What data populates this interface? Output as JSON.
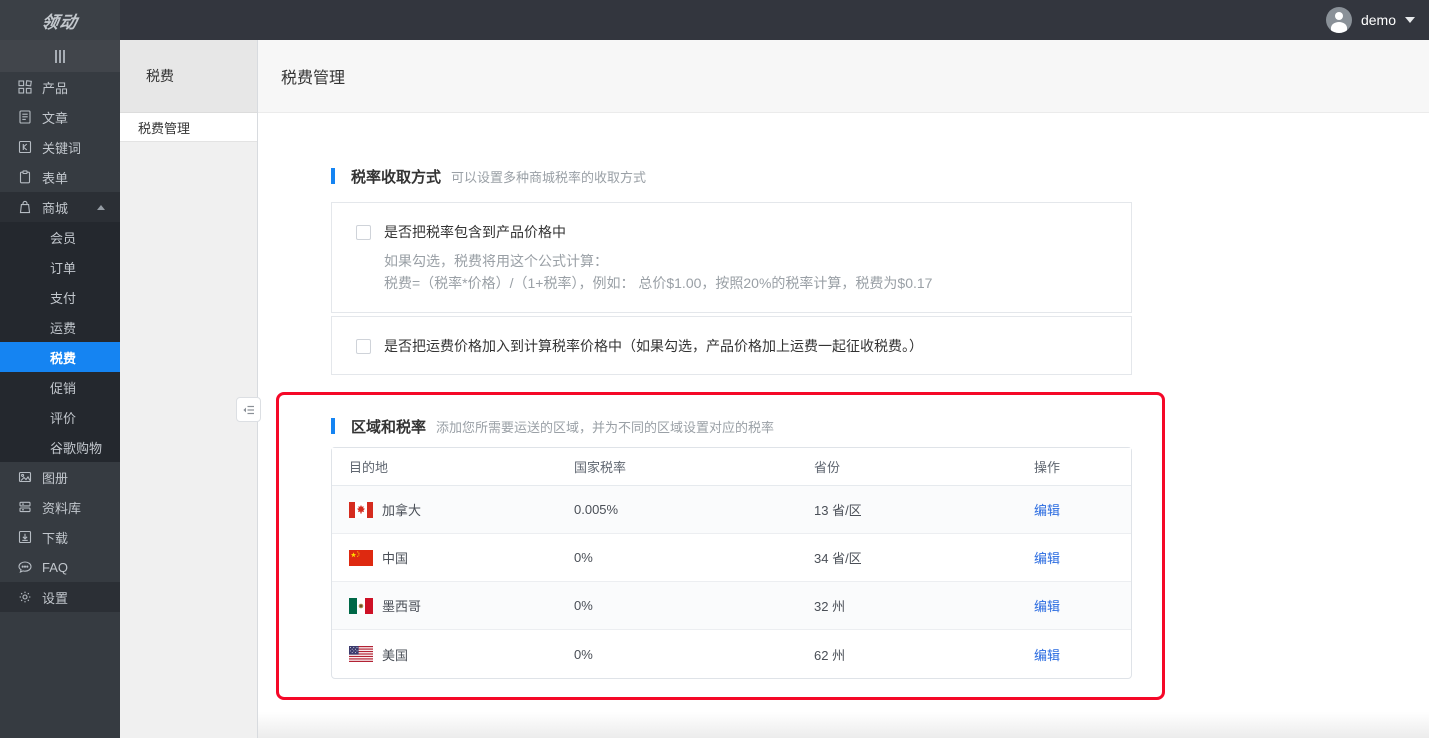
{
  "topbar": {
    "logo": "领动",
    "user": "demo"
  },
  "sidebar": {
    "items": [
      {
        "label": "产品",
        "icon": "grid-icon"
      },
      {
        "label": "文章",
        "icon": "article-icon"
      },
      {
        "label": "关键词",
        "icon": "keyword-icon"
      },
      {
        "label": "表单",
        "icon": "form-icon"
      },
      {
        "label": "商城",
        "icon": "mall-icon",
        "expanded": true,
        "children": [
          "会员",
          "订单",
          "支付",
          "运费",
          "税费",
          "促销",
          "评价",
          "谷歌购物"
        ],
        "selected_child": "税费"
      },
      {
        "label": "图册",
        "icon": "album-icon"
      },
      {
        "label": "资料库",
        "icon": "library-icon"
      },
      {
        "label": "下载",
        "icon": "download-icon"
      },
      {
        "label": "FAQ",
        "icon": "faq-icon"
      },
      {
        "label": "设置",
        "icon": "gear-icon",
        "darker": true
      }
    ]
  },
  "subsidebar": {
    "title": "税费",
    "items": [
      {
        "label": "税费管理",
        "active": true
      }
    ]
  },
  "page": {
    "title": "税费管理"
  },
  "sections": [
    {
      "title": "税率收取方式",
      "subtitle": "可以设置多种商城税率的收取方式"
    },
    {
      "title": "区域和税率",
      "subtitle": "添加您所需要运送的区域，并为不同的区域设置对应的税率"
    }
  ],
  "tax_options": [
    {
      "label": "是否把税率包含到产品价格中",
      "checked": false,
      "help_lines": [
        "如果勾选，税费将用这个公式计算：",
        "税费=（税率*价格）/（1+税率），例如： 总价$1.00，按照20%的税率计算，税费为$0.17"
      ]
    },
    {
      "label": "是否把运费价格加入到计算税率价格中（如果勾选，产品价格加上运费一起征收税费。）",
      "checked": false,
      "help_lines": []
    }
  ],
  "tax_table": {
    "columns": [
      "目的地",
      "国家税率",
      "省份",
      "操作"
    ],
    "rows": [
      {
        "country": "加拿大",
        "flag": "canada-flag",
        "rate": "0.005%",
        "provinces": "13 省/区",
        "action": "编辑"
      },
      {
        "country": "中国",
        "flag": "china-flag",
        "rate": "0%",
        "provinces": "34 省/区",
        "action": "编辑"
      },
      {
        "country": "墨西哥",
        "flag": "mexico-flag",
        "rate": "0%",
        "provinces": "32 州",
        "action": "编辑"
      },
      {
        "country": "美国",
        "flag": "usa-flag",
        "rate": "0%",
        "provinces": "62 州",
        "action": "编辑"
      }
    ]
  },
  "colors": {
    "accent_blue": "#1584f2",
    "link_blue": "#2a6be0",
    "highlight_red": "#f50828",
    "topbar_bg": "#33363e",
    "sidebar_bg": "#363b41",
    "submenu_bg": "#24282e"
  }
}
